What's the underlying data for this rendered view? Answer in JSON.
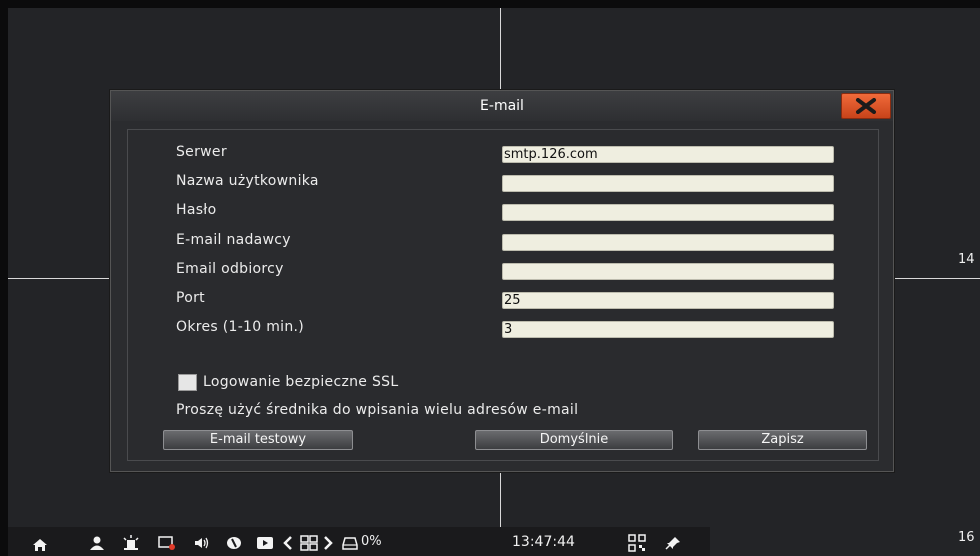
{
  "dialog": {
    "title": "E-mail",
    "close_icon": "close-x-icon",
    "fields": [
      {
        "label": "Serwer",
        "value": "smtp.126.com"
      },
      {
        "label": "Nazwa użytkownika",
        "value": ""
      },
      {
        "label": "Hasło",
        "value": ""
      },
      {
        "label": "E-mail nadawcy",
        "value": ""
      },
      {
        "label": "Email odbiorcy",
        "value": ""
      },
      {
        "label": "Port",
        "value": "25"
      },
      {
        "label": "Okres (1-10 min.)",
        "value": "3"
      }
    ],
    "ssl_label": "Logowanie bezpieczne SSL",
    "ssl_checked": false,
    "hint": "Proszę użyć średnika do wpisania wielu adresów e-mail",
    "buttons": {
      "test": "E-mail testowy",
      "defaults": "Domyślnie",
      "save": "Zapisz"
    }
  },
  "channels": {
    "ch14": "14",
    "ch16": "16"
  },
  "taskbar": {
    "icons": [
      "home-icon",
      "user-icon",
      "alarm-icon",
      "record-icon",
      "volume-icon",
      "ptz-icon",
      "playback-icon",
      "prev-icon",
      "layout-grid-icon",
      "next-icon",
      "disk-icon",
      "qr-code-icon",
      "pin-icon"
    ],
    "hdd_percent": "0%",
    "time": "13:47:44"
  },
  "colors": {
    "close_button": "#e0552a",
    "field_bg": "#efeee0",
    "background": "#232427"
  }
}
